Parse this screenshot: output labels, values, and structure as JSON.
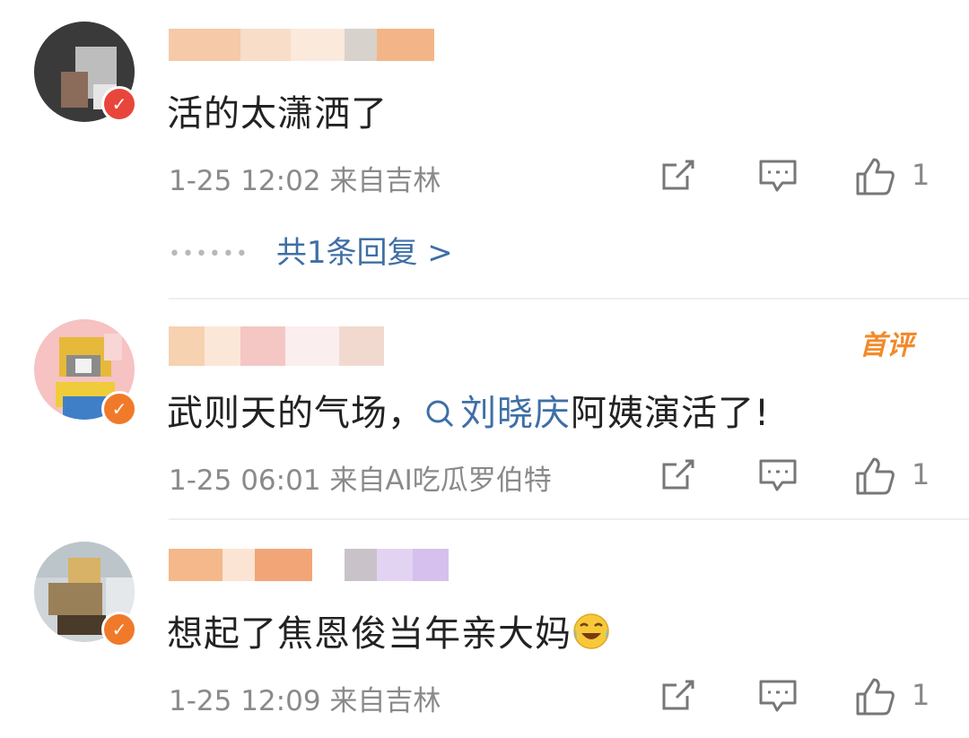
{
  "comments": [
    {
      "text": "活的太潇洒了",
      "time": "1-25 12:02",
      "location": "来自吉林",
      "likes": "1",
      "replies_label": "共1条回复 >"
    },
    {
      "text_before": "武则天的气场，",
      "link_text": "刘晓庆",
      "text_after": "阿姨演活了!",
      "badge": "首评",
      "time": "1-25 06:01",
      "location": "来自AI吃瓜罗伯特",
      "likes": "1"
    },
    {
      "text": "想起了焦恩俊当年亲大妈",
      "emoji": "laughing-crying-emoji",
      "time": "1-25 12:09",
      "location": "来自吉林",
      "likes": "1"
    }
  ],
  "icons": [
    "share-icon",
    "comment-icon",
    "like-icon",
    "search-icon",
    "verified-badge-icon"
  ],
  "colors": {
    "link": "#3f6fa6",
    "badge": "#f28a2b",
    "meta": "#8a8a8a",
    "verified": "#f07a2a"
  }
}
